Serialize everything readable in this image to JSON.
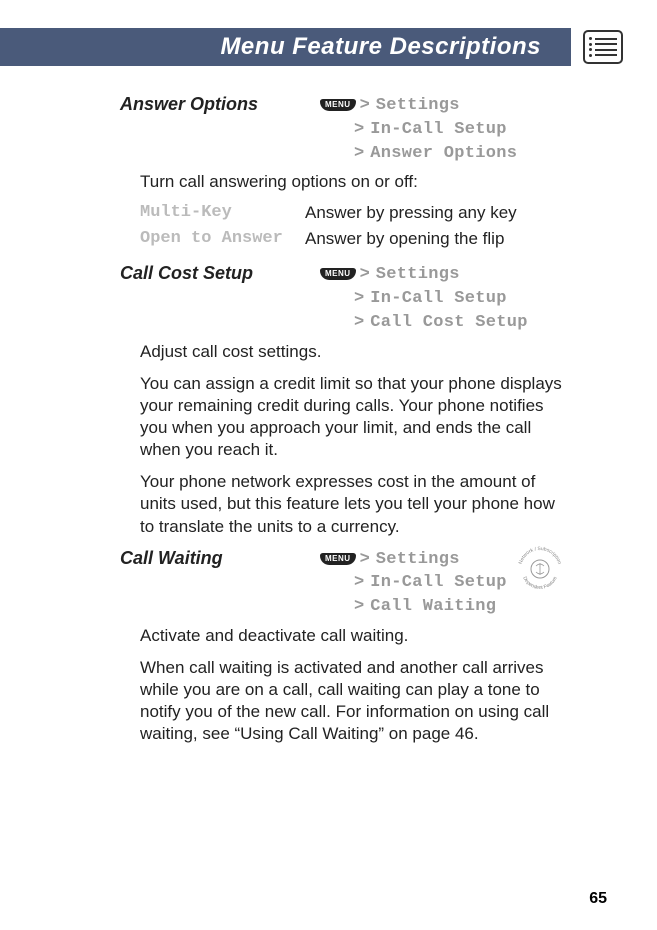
{
  "header": {
    "title": "Menu Feature Descriptions"
  },
  "sections": {
    "answer_options": {
      "title": "Answer Options",
      "menu_label": "MENU",
      "path": [
        "Settings",
        "In-Call Setup",
        "Answer Options"
      ],
      "intro": "Turn call answering options on or off:",
      "options": [
        {
          "label": "Multi-Key",
          "desc": "Answer by pressing any key"
        },
        {
          "label": "Open to Answer",
          "desc": "Answer by opening the flip"
        }
      ]
    },
    "call_cost": {
      "title": "Call Cost Setup",
      "menu_label": "MENU",
      "path": [
        "Settings",
        "In-Call Setup",
        "Call Cost Setup"
      ],
      "intro": "Adjust call cost settings.",
      "para1": "You can assign a credit limit so that your phone displays your remaining credit during calls. Your phone notifies you when you approach your limit, and ends the call when you reach it.",
      "para2": "Your phone network expresses cost in the amount of units used, but this feature lets you tell your phone how to translate the units to a currency."
    },
    "call_waiting": {
      "title": "Call Waiting",
      "menu_label": "MENU",
      "path": [
        "Settings",
        "In-Call Setup",
        "Call Waiting"
      ],
      "stamp_text": "Network / Subscription Dependent Feature",
      "intro": "Activate and deactivate call waiting.",
      "para1": "When call waiting is activated and another call arrives while you are on a call, call waiting can play a tone to notify you of the new call. For information on using call waiting, see “Using Call Waiting” on page 46."
    }
  },
  "page_number": "65"
}
